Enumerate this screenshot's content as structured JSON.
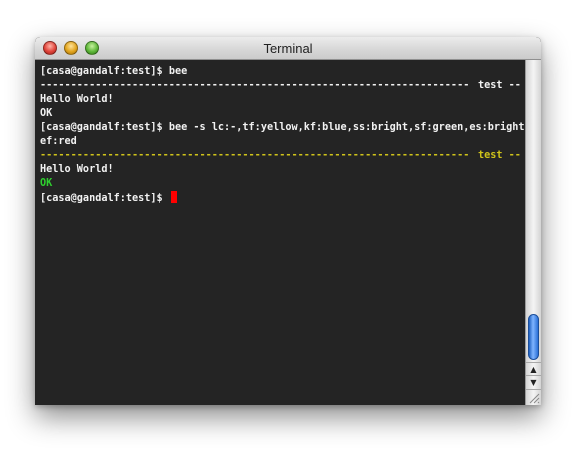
{
  "window": {
    "title": "Terminal"
  },
  "terminal": {
    "line1_prompt": "[casa@gandalf:test]$ ",
    "line1_cmd": "bee",
    "sep1_dashes": "------------------------------------------------------------------------------------------------------------",
    "sep1_label": "test --",
    "line3": "Hello World!",
    "line4": "OK",
    "line5_prompt": "[casa@gandalf:test]$ ",
    "line5_cmd": "bee -s lc:-,tf:yellow,kf:blue,ss:bright,sf:green,es:bright,",
    "line6": "ef:red",
    "sep2_dashes": "------------------------------------------------------------------------------------------------------------",
    "sep2_label": "test --",
    "line8": "Hello World!",
    "line9": "OK",
    "line10_prompt": "[casa@gandalf:test]$ "
  },
  "colors": {
    "background": "#242424",
    "text": "#f2f2f2",
    "yellow": "#cfc31a",
    "green": "#2fd02f",
    "cursor": "#ff0000"
  },
  "icons": {
    "close": "close-button-icon",
    "minimize": "minimize-button-icon",
    "zoom": "zoom-button-icon",
    "scroll_up": "▲",
    "scroll_down": "▼",
    "resize_grip": "resize-grip-icon"
  }
}
